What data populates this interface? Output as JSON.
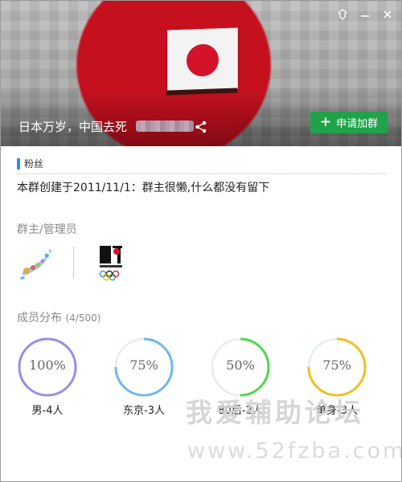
{
  "window": {
    "controls": [
      "pin-icon",
      "minimize-icon",
      "close-icon"
    ]
  },
  "header": {
    "group_name": "日本万岁，中国去死",
    "apply_label": "申请加群",
    "accent": "#1fa24a"
  },
  "tag": {
    "label": "粉丝",
    "color": "#2f8ee5"
  },
  "description": "本群创建于2011/11/1：群主很懒,什么都没有留下",
  "admins": {
    "title": "群主/管理员",
    "avatars": [
      "japan-map-avatar",
      "tokyo-olympic-logo-avatar"
    ]
  },
  "members": {
    "title": "成员分布",
    "count": "(4/500)",
    "stats": [
      {
        "percent": "100%",
        "value": 1.0,
        "label": "男-4人",
        "color": "#9a8ee6"
      },
      {
        "percent": "75%",
        "value": 0.75,
        "label": "东京-3人",
        "color": "#6fb8f0"
      },
      {
        "percent": "50%",
        "value": 0.5,
        "label": "80后-2人",
        "color": "#4fd64f"
      },
      {
        "percent": "75%",
        "value": 0.75,
        "label": "单身-3人",
        "color": "#f0c020"
      }
    ]
  },
  "watermark": {
    "line1": "我爱辅助论坛",
    "line2": "www.52fzba.com"
  }
}
